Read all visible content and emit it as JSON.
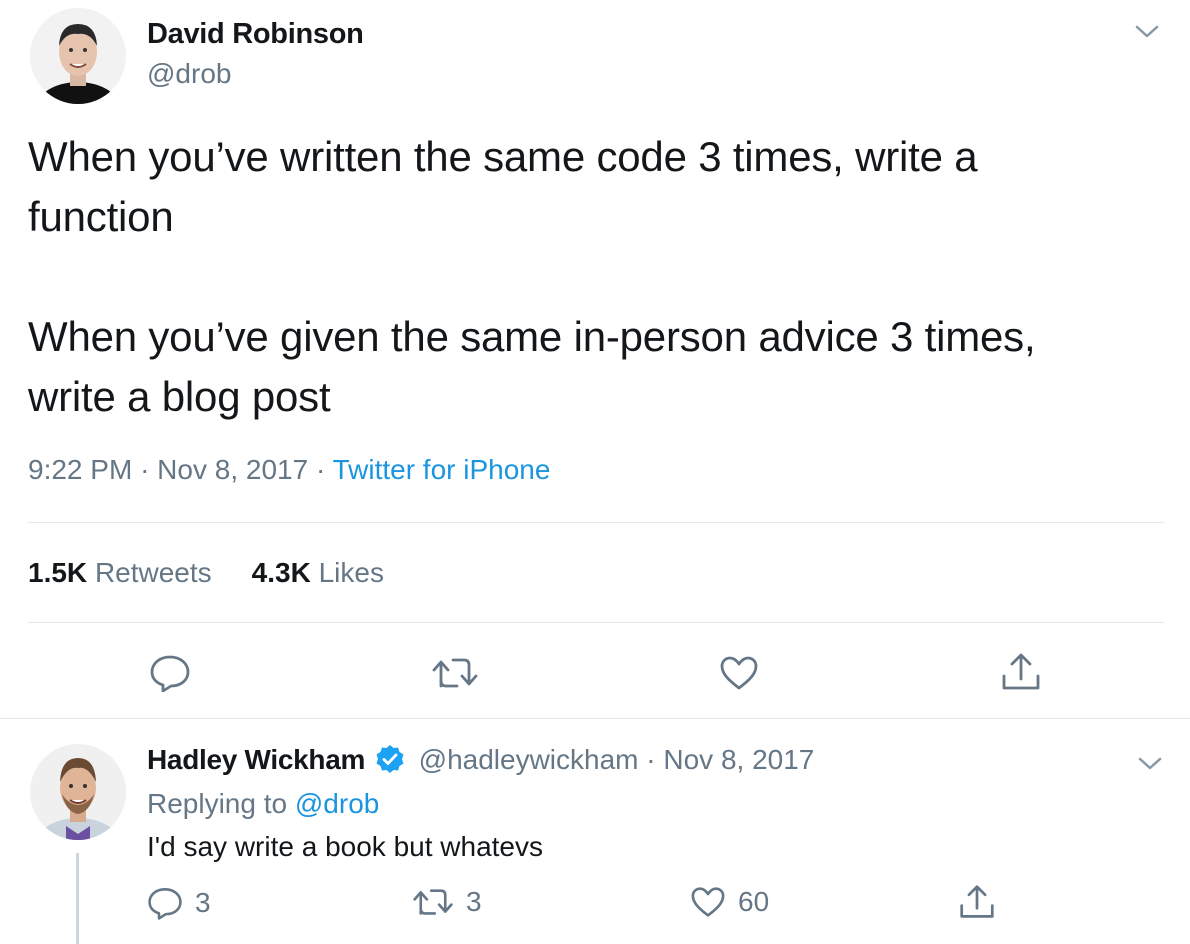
{
  "main_tweet": {
    "author_name": "David Robinson",
    "author_handle": "@drob",
    "text": "When you’ve written the same code 3 times, write a\nfunction\n\nWhen you’ve given the same in-person advice 3 times,\nwrite a blog post",
    "time": "9:22 PM",
    "separator": "·",
    "date": "Nov 8, 2017",
    "source": "Twitter for iPhone",
    "retweets_count": "1.5K",
    "retweets_label": "Retweets",
    "likes_count": "4.3K",
    "likes_label": "Likes",
    "icons": [
      "chevron-down-icon",
      "reply-icon",
      "retweet-icon",
      "like-icon",
      "share-icon"
    ]
  },
  "reply_tweet": {
    "author_name": "Hadley Wickham",
    "verified": true,
    "author_handle": "@hadleywickham",
    "separator": "·",
    "date": "Nov 8, 2017",
    "replying_prefix": "Replying to",
    "replying_to": "@drob",
    "text": "I'd say write a book but whatevs",
    "reply_count": "3",
    "retweet_count": "3",
    "like_count": "60",
    "icons": [
      "chevron-down-icon",
      "verified-badge-icon",
      "reply-icon",
      "retweet-icon",
      "like-icon",
      "share-icon"
    ]
  },
  "colors": {
    "text": "#14171a",
    "secondary": "#657786",
    "link": "#1b95e0",
    "divider": "#e1e8ed",
    "verified": "#1da1f2"
  }
}
